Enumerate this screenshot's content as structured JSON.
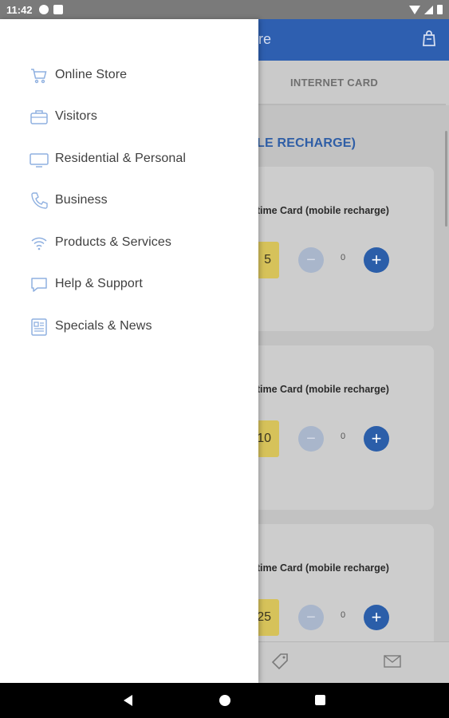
{
  "status_bar": {
    "time": "11:42",
    "icons": [
      "f-icon",
      "sim-icon",
      "wifi-icon",
      "signal-icon",
      "battery-icon"
    ]
  },
  "app": {
    "title_partial": "re",
    "tab_label": "INTERNET CARD",
    "section_title": "LE RECHARGE)",
    "cards": [
      {
        "title": "rtime Card (mobile recharge)",
        "price": "5",
        "quantity": "0"
      },
      {
        "title": "rtime Card (mobile recharge)",
        "price": "10",
        "quantity": "0"
      },
      {
        "title": "rtime Card (mobile recharge)",
        "price": "25",
        "quantity": "0"
      }
    ],
    "minus_label": "−",
    "plus_label": "+",
    "colors": {
      "primary": "#2e5fb0",
      "price_badge": "#d6c25a",
      "accent_text": "#2f5ea6"
    }
  },
  "drawer": {
    "items": [
      {
        "label": "Online Store",
        "icon": "cart-icon"
      },
      {
        "label": "Visitors",
        "icon": "briefcase-icon"
      },
      {
        "label": "Residential & Personal",
        "icon": "monitor-icon"
      },
      {
        "label": "Business",
        "icon": "phone-icon"
      },
      {
        "label": "Products & Services",
        "icon": "wifi-icon"
      },
      {
        "label": "Help & Support",
        "icon": "chat-icon"
      },
      {
        "label": "Specials & News",
        "icon": "newspaper-icon"
      }
    ],
    "icon_color": "#8fb0e0"
  },
  "nav_bar": {
    "buttons": [
      "back",
      "home",
      "recents"
    ]
  }
}
